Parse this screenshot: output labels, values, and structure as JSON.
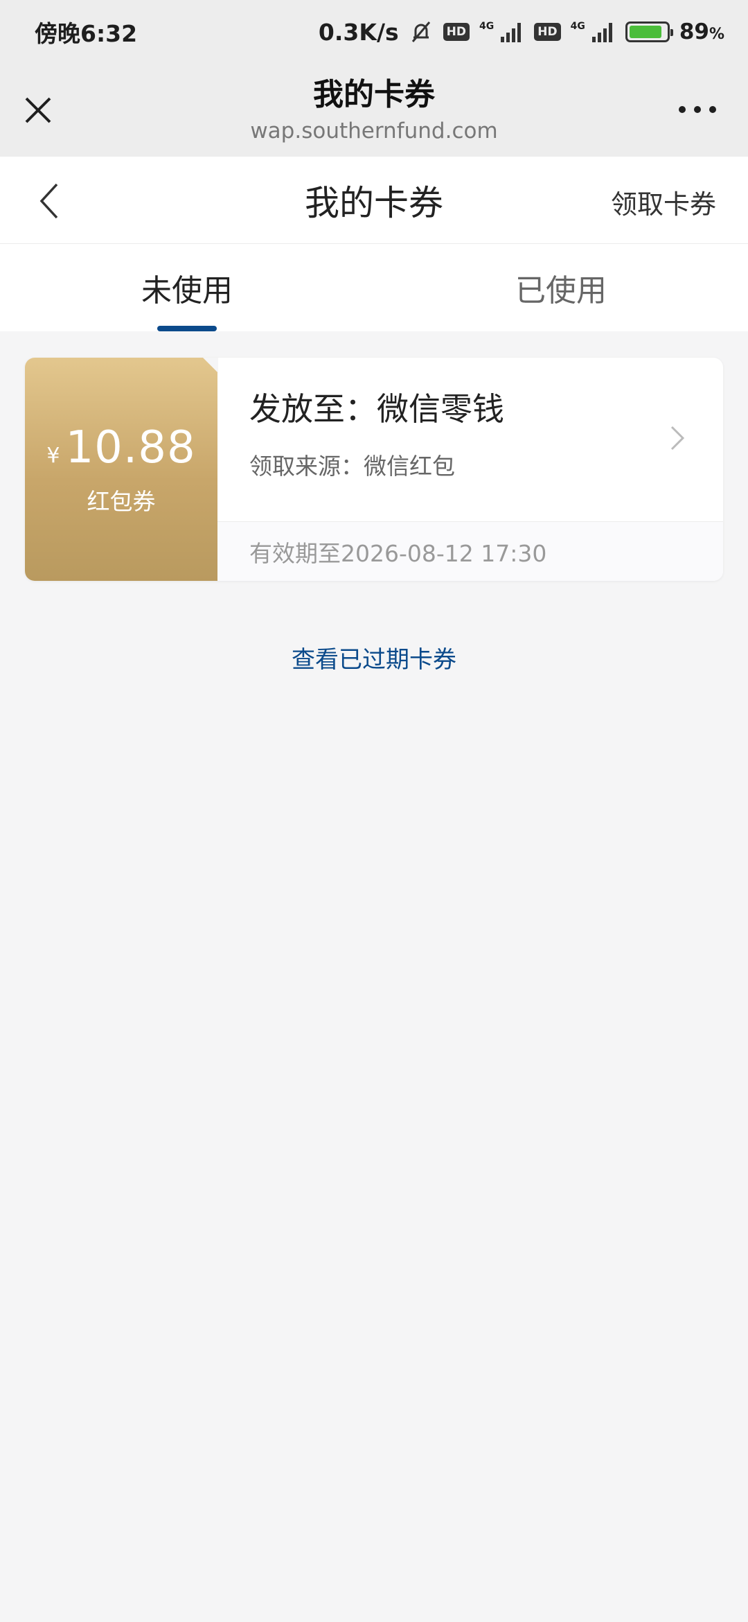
{
  "status_bar": {
    "time": "傍晚6:32",
    "net_speed": "0.3K/s",
    "hd1": "HD",
    "net1": "4G",
    "hd2": "HD",
    "net2": "4G",
    "battery_percent": "89",
    "battery_unit": "%"
  },
  "wechat_bar": {
    "title": "我的卡券",
    "url": "wap.southernfund.com"
  },
  "navbar": {
    "title": "我的卡券",
    "right_action": "领取卡券"
  },
  "tabs": [
    {
      "label": "未使用",
      "active": true
    },
    {
      "label": "已使用",
      "active": false
    }
  ],
  "coupon": {
    "currency": "¥",
    "amount": "10.88",
    "type": "红包券",
    "destination": "发放至：微信零钱",
    "source": "领取来源：微信红包",
    "validity": "有效期至2026-08-12 17:30"
  },
  "expired_link": "查看已过期卡券",
  "colors": {
    "accent": "#0b4a8b",
    "coupon_gold_light": "#e3c78e",
    "coupon_gold_dark": "#b99a5f"
  }
}
